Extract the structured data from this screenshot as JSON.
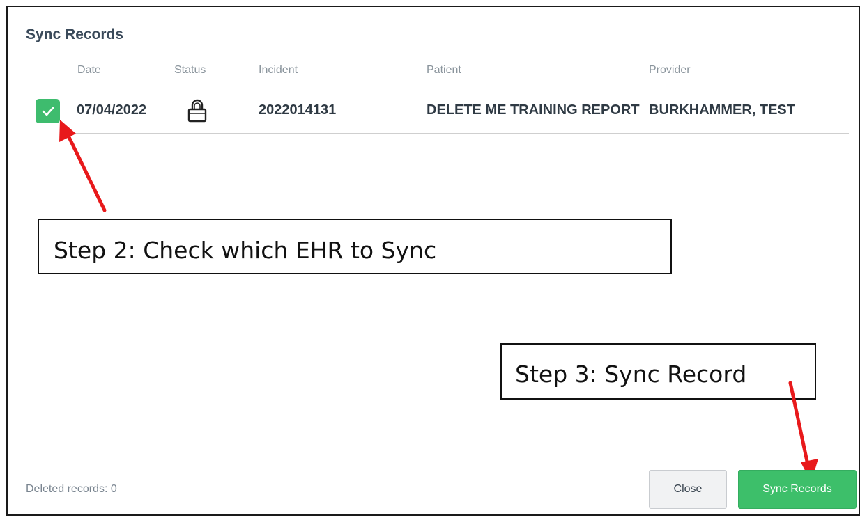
{
  "dialog": {
    "title": "Sync Records"
  },
  "table": {
    "columns": {
      "date": "Date",
      "status": "Status",
      "incident": "Incident",
      "patient": "Patient",
      "provider": "Provider"
    },
    "rows": [
      {
        "checked": true,
        "date": "07/04/2022",
        "status_icon": "lock-icon",
        "incident": "2022014131",
        "patient": "DELETE ME TRAINING REPORT",
        "provider": "BURKHAMMER, TEST"
      }
    ]
  },
  "annotations": {
    "step2": "Step 2: Check which EHR to Sync",
    "step3": "Step 3: Sync Record",
    "arrow_color": "#e8191b"
  },
  "footer": {
    "deleted_records": "Deleted records: 0",
    "close_label": "Close",
    "sync_label": "Sync Records"
  },
  "colors": {
    "accent_green": "#3dbf6a",
    "text_dark": "#2f3a44"
  }
}
